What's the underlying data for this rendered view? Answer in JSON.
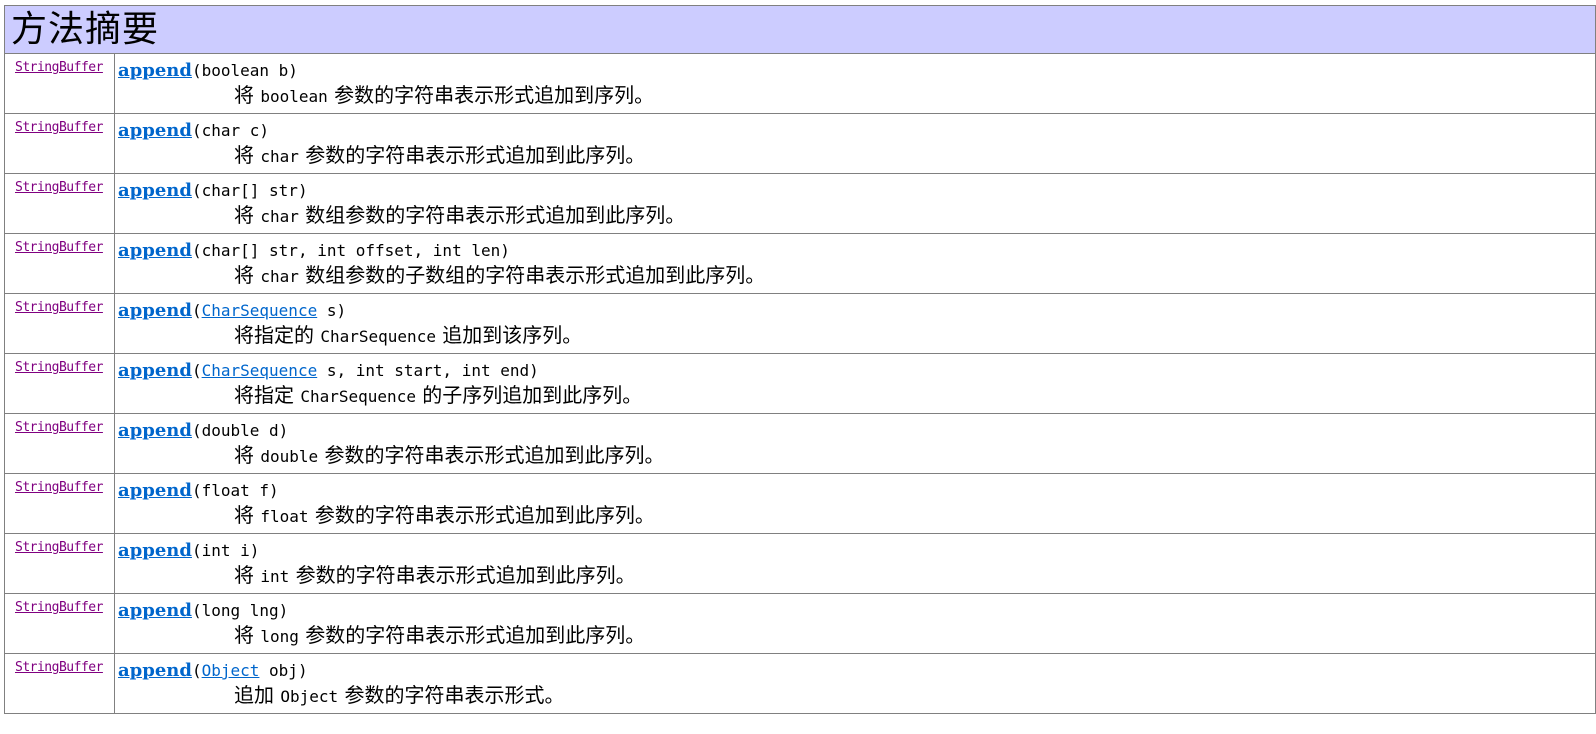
{
  "header": {
    "title": "方法摘要"
  },
  "rows": [
    {
      "return_type": "StringBuffer",
      "method": "append",
      "sig_open": "(",
      "param_link": "",
      "sig_rest": "boolean b)",
      "desc_before": "将 ",
      "desc_code": "boolean",
      "desc_after": " 参数的字符串表示形式追加到序列。"
    },
    {
      "return_type": "StringBuffer",
      "method": "append",
      "sig_open": "(",
      "param_link": "",
      "sig_rest": "char c)",
      "desc_before": "将 ",
      "desc_code": "char",
      "desc_after": " 参数的字符串表示形式追加到此序列。"
    },
    {
      "return_type": "StringBuffer",
      "method": "append",
      "sig_open": "(",
      "param_link": "",
      "sig_rest": "char[] str)",
      "desc_before": "将 ",
      "desc_code": "char",
      "desc_after": " 数组参数的字符串表示形式追加到此序列。"
    },
    {
      "return_type": "StringBuffer",
      "method": "append",
      "sig_open": "(",
      "param_link": "",
      "sig_rest": "char[] str, int offset, int len)",
      "desc_before": "将 ",
      "desc_code": "char",
      "desc_after": " 数组参数的子数组的字符串表示形式追加到此序列。"
    },
    {
      "return_type": "StringBuffer",
      "method": "append",
      "sig_open": "(",
      "param_link": "CharSequence",
      "sig_rest": " s)",
      "desc_before": "将指定的 ",
      "desc_code": "CharSequence",
      "desc_after": " 追加到该序列。"
    },
    {
      "return_type": "StringBuffer",
      "method": "append",
      "sig_open": "(",
      "param_link": "CharSequence",
      "sig_rest": " s, int start, int end)",
      "desc_before": "将指定 ",
      "desc_code": "CharSequence",
      "desc_after": " 的子序列追加到此序列。"
    },
    {
      "return_type": "StringBuffer",
      "method": "append",
      "sig_open": "(",
      "param_link": "",
      "sig_rest": "double d)",
      "desc_before": "将 ",
      "desc_code": "double",
      "desc_after": " 参数的字符串表示形式追加到此序列。"
    },
    {
      "return_type": "StringBuffer",
      "method": "append",
      "sig_open": "(",
      "param_link": "",
      "sig_rest": "float f)",
      "desc_before": "将 ",
      "desc_code": "float",
      "desc_after": " 参数的字符串表示形式追加到此序列。"
    },
    {
      "return_type": "StringBuffer",
      "method": "append",
      "sig_open": "(",
      "param_link": "",
      "sig_rest": "int i)",
      "desc_before": "将 ",
      "desc_code": "int",
      "desc_after": " 参数的字符串表示形式追加到此序列。"
    },
    {
      "return_type": "StringBuffer",
      "method": "append",
      "sig_open": "(",
      "param_link": "",
      "sig_rest": "long lng)",
      "desc_before": "将 ",
      "desc_code": "long",
      "desc_after": " 参数的字符串表示形式追加到此序列。"
    },
    {
      "return_type": "StringBuffer",
      "method": "append",
      "sig_open": "(",
      "param_link": "Object",
      "sig_rest": " obj)",
      "desc_before": "追加 ",
      "desc_code": "Object",
      "desc_after": " 参数的字符串表示形式。"
    }
  ],
  "colors": {
    "header_bg": "#CCCCFF",
    "visited_link": "#800080",
    "link": "#0066CC",
    "border": "#808080"
  }
}
